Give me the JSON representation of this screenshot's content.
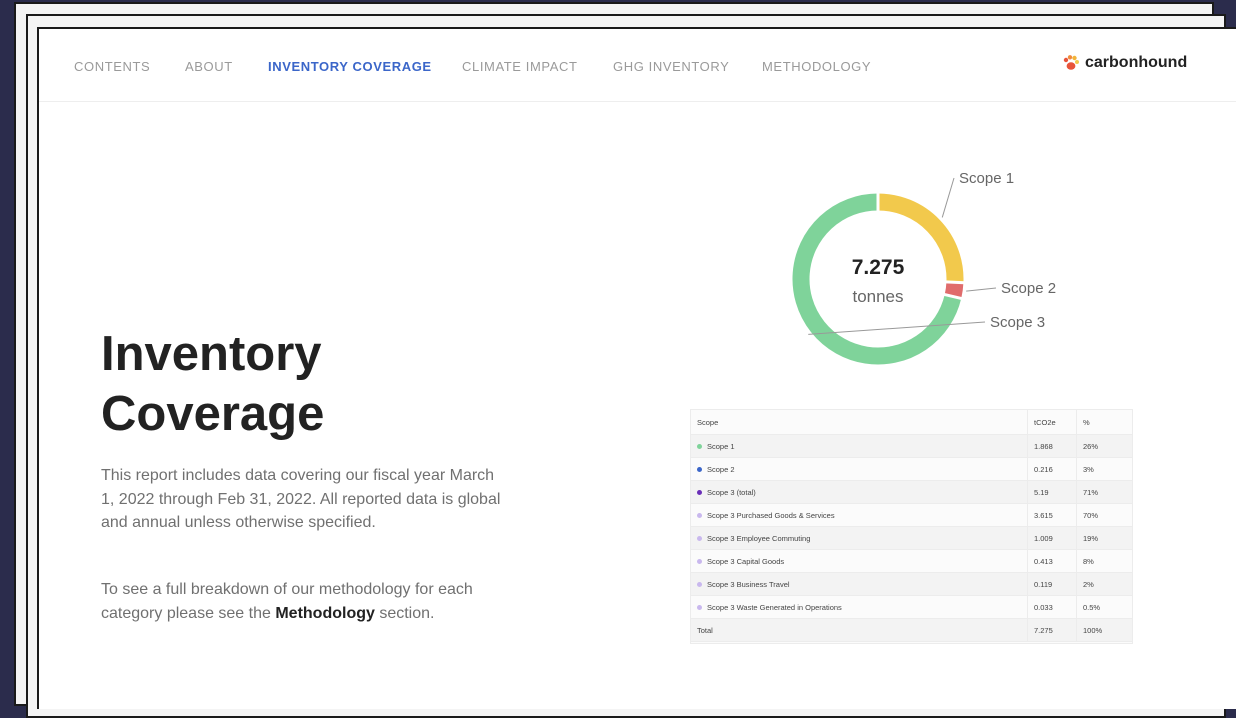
{
  "nav": {
    "items": [
      {
        "label": "CONTENTS"
      },
      {
        "label": "ABOUT"
      },
      {
        "label": "INVENTORY COVERAGE"
      },
      {
        "label": "CLIMATE IMPACT"
      },
      {
        "label": "GHG INVENTORY"
      },
      {
        "label": "METHODOLOGY"
      }
    ],
    "active": "INVENTORY COVERAGE",
    "logo_text": "carbonhound"
  },
  "hero": {
    "title_line1": "Inventory",
    "title_line2": "Coverage",
    "paragraph1": "This report includes data covering our fiscal year March 1, 2022 through Feb 31, 2022. All reported data is global and annual unless otherwise specified.",
    "paragraph2_before": "To see a full breakdown of our methodology for each category please see the ",
    "paragraph2_bold": "Methodology",
    "paragraph2_after": " section."
  },
  "chart_data": {
    "type": "pie",
    "center_value": "7.275",
    "center_unit": "tonnes",
    "labels": [
      "Scope 1",
      "Scope 2",
      "Scope 3"
    ],
    "values": [
      1.868,
      0.216,
      5.19
    ],
    "colors": [
      "#f2c94c",
      "#e06c6c",
      "#7fd39a"
    ]
  },
  "table": {
    "headers": [
      "Scope",
      "tCO2e",
      "%"
    ],
    "rows": [
      {
        "name": "Scope 1",
        "value": "1.868",
        "pct": "26%",
        "dot": "#7fd39a"
      },
      {
        "name": "Scope 2",
        "value": "0.216",
        "pct": "3%",
        "dot": "#3b66c9"
      },
      {
        "name": "Scope 3 (total)",
        "value": "5.19",
        "pct": "71%",
        "dot": "#6a2fb8"
      },
      {
        "name": "Scope 3 Purchased Goods & Services",
        "value": "3.615",
        "pct": "70%",
        "dot": "#c9b8ee"
      },
      {
        "name": "Scope 3 Employee Commuting",
        "value": "1.009",
        "pct": "19%",
        "dot": "#c9b8ee"
      },
      {
        "name": "Scope 3 Capital Goods",
        "value": "0.413",
        "pct": "8%",
        "dot": "#c9b8ee"
      },
      {
        "name": "Scope 3 Business Travel",
        "value": "0.119",
        "pct": "2%",
        "dot": "#c9b8ee"
      },
      {
        "name": "Scope 3 Waste Generated in Operations",
        "value": "0.033",
        "pct": "0.5%",
        "dot": "#c9b8ee"
      },
      {
        "name": "Total",
        "value": "7.275",
        "pct": "100%",
        "dot": ""
      }
    ]
  }
}
